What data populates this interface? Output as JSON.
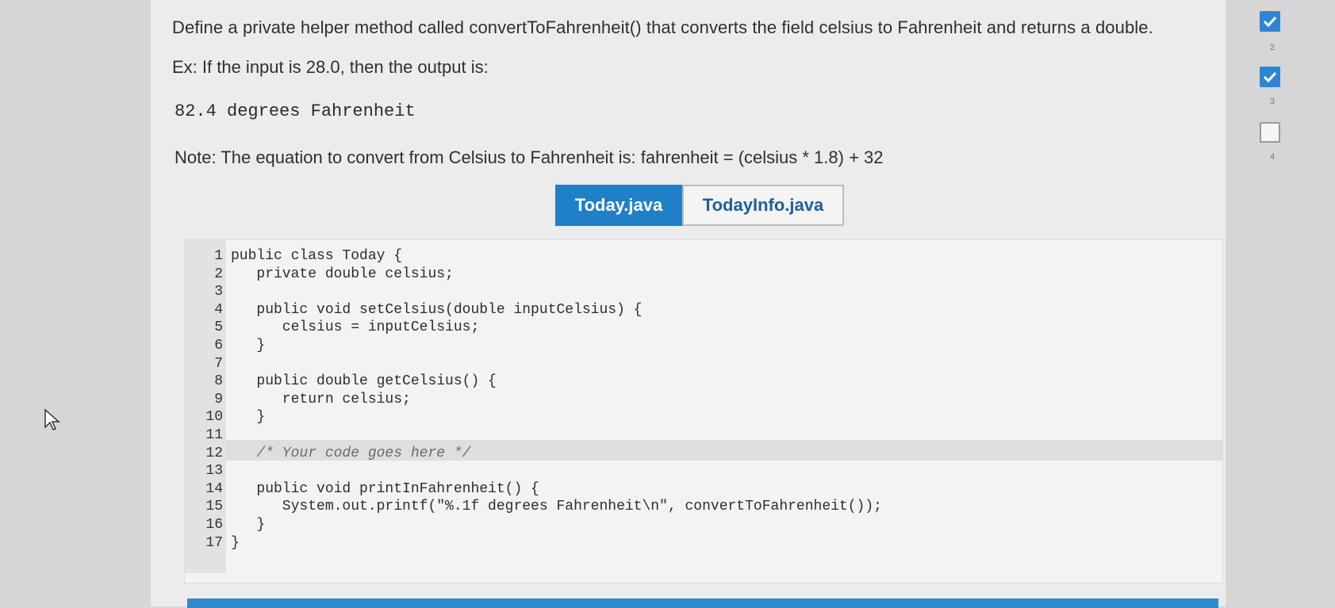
{
  "prompt": {
    "instruction": "Define a private helper method called convertToFahrenheit() that converts the field celsius to Fahrenheit and returns a double.",
    "example": "Ex: If the input is 28.0, then the output is:",
    "output": "82.4 degrees Fahrenheit",
    "note": "Note: The equation to convert from Celsius to Fahrenheit is: fahrenheit = (celsius * 1.8) + 32"
  },
  "tabs": [
    {
      "label": "Today.java",
      "active": true
    },
    {
      "label": "TodayInfo.java",
      "active": false
    }
  ],
  "editor": {
    "lines": [
      {
        "num": "1",
        "text": "public class Today {"
      },
      {
        "num": "2",
        "text": "   private double celsius;"
      },
      {
        "num": "3",
        "text": ""
      },
      {
        "num": "4",
        "text": "   public void setCelsius(double inputCelsius) {"
      },
      {
        "num": "5",
        "text": "      celsius = inputCelsius;"
      },
      {
        "num": "6",
        "text": "   }"
      },
      {
        "num": "7",
        "text": ""
      },
      {
        "num": "8",
        "text": "   public double getCelsius() {"
      },
      {
        "num": "9",
        "text": "      return celsius;"
      },
      {
        "num": "10",
        "text": "   }"
      },
      {
        "num": "11",
        "text": ""
      },
      {
        "num": "12",
        "text": "   /* Your code goes here */"
      },
      {
        "num": "13",
        "text": ""
      },
      {
        "num": "14",
        "text": "   public void printInFahrenheit() {"
      },
      {
        "num": "15",
        "text": "      System.out.printf(\"%.1f degrees Fahrenheit\\n\", convertToFahrenheit());"
      },
      {
        "num": "16",
        "text": "   }"
      },
      {
        "num": "17",
        "text": "}"
      }
    ]
  },
  "progress": {
    "steps": [
      {
        "label": "",
        "done": true
      },
      {
        "label": "2",
        "done": true
      },
      {
        "label": "3",
        "done": false
      },
      {
        "label": "4",
        "done": null
      }
    ]
  },
  "colors": {
    "accent": "#1f80c8",
    "check_done": "#2d86d4"
  },
  "icons": {
    "cursor": "mouse-pointer-icon",
    "check": "checkmark-icon"
  }
}
